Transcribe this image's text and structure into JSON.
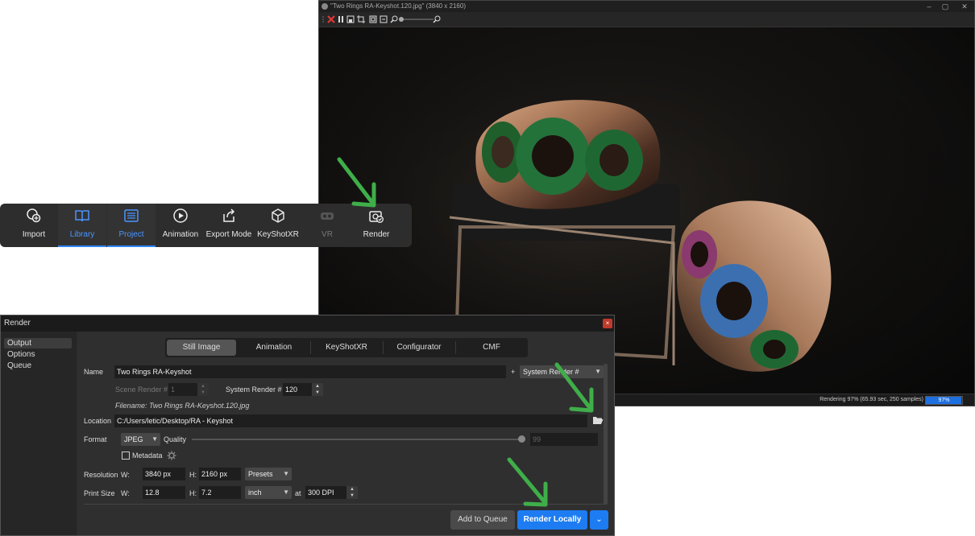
{
  "render_window": {
    "title": "\"Two Rings RA-Keyshot.120.jpg\" (3840 x 2160)",
    "status": "Rendering 97% (65.93 sec, 250 samples)",
    "progress_label": "97%",
    "progress": 0.97
  },
  "ribbon": {
    "items": [
      {
        "label": "Import"
      },
      {
        "label": "Library"
      },
      {
        "label": "Project"
      },
      {
        "label": "Animation"
      },
      {
        "label": "Export Mode"
      },
      {
        "label": "KeyShotXR"
      },
      {
        "label": "VR"
      },
      {
        "label": "Render"
      }
    ]
  },
  "dialog": {
    "title": "Render",
    "close": "×",
    "sidebar": [
      {
        "label": "Output"
      },
      {
        "label": "Options"
      },
      {
        "label": "Queue"
      }
    ],
    "tabs": [
      {
        "label": "Still Image"
      },
      {
        "label": "Animation"
      },
      {
        "label": "KeyShotXR"
      },
      {
        "label": "Configurator"
      },
      {
        "label": "CMF"
      }
    ],
    "name_label": "Name",
    "name_value": "Two Rings RA-Keyshot",
    "plus": "+",
    "name_suffix": "System Render #",
    "scene_render_label": "Scene Render #",
    "scene_render_value": "1",
    "system_render_label": "System Render #",
    "system_render_value": "120",
    "filename": "Filename: Two Rings RA-Keyshot.120.jpg",
    "location_label": "Location",
    "location_value": "C:/Users/letic/Desktop/RA - Keyshot",
    "format_label": "Format",
    "format_value": "JPEG",
    "quality_label": "Quality",
    "quality_value": "99",
    "metadata_label": "Metadata",
    "resolution_label": "Resolution",
    "w_label": "W:",
    "h_label": "H:",
    "res_w": "3840 px",
    "res_h": "2160 px",
    "presets": "Presets",
    "print_label": "Print Size",
    "print_w": "12.8",
    "print_h": "7.2",
    "print_unit": "inch",
    "at_label": "at",
    "dpi": "300 DPI",
    "add_queue": "Add to Queue",
    "render_locally": "Render Locally"
  },
  "colors": {
    "accent": "#1d7cf2",
    "arrow": "#3fae49"
  }
}
